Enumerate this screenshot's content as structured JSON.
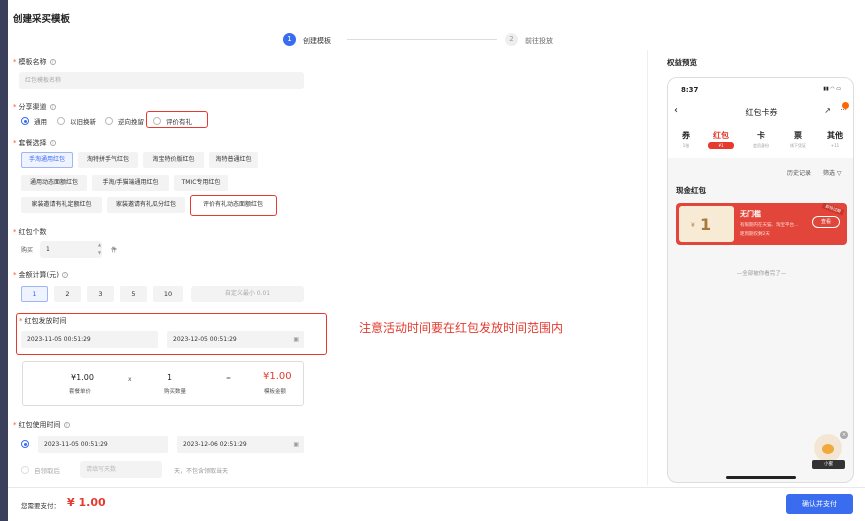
{
  "page": {
    "title": "创建采买模板"
  },
  "steps": [
    {
      "num": "1",
      "label": "创建模板"
    },
    {
      "num": "2",
      "label": "前往投放"
    }
  ],
  "template_name": {
    "label": "模板名称",
    "placeholder": "红包模板名称"
  },
  "share_channel": {
    "label": "分享渠道",
    "options": [
      "通用",
      "以旧换新",
      "逆向挽留",
      "评价有礼"
    ],
    "selected": "通用"
  },
  "package": {
    "label": "套餐选择",
    "options": [
      [
        "手淘通用红包",
        "淘特拼手气红包",
        "淘宝特价版红包",
        "淘特普通红包"
      ],
      [
        "通用动态面额红包",
        "手淘/手猫端通用红包",
        "TMIC专用红包"
      ],
      [
        "家装邀请有礼定额红包",
        "家装邀请有礼瓜分红包",
        "评价有礼动态面额红包"
      ]
    ],
    "selected": "手淘通用红包"
  },
  "count": {
    "label": "红包个数",
    "prefix": "购买",
    "value": "1",
    "unit": "件"
  },
  "amount": {
    "label": "金额计算(元)",
    "options": [
      "1",
      "2",
      "3",
      "5",
      "10"
    ],
    "selected": "1",
    "custom_placeholder": "自定义最小 0.01"
  },
  "issue_time": {
    "label": "红包发放时间",
    "start": "2023-11-05 00:51:29",
    "end": "2023-12-05 00:51:29"
  },
  "summary": {
    "unit_price": "¥1.00",
    "unit_price_label": "套餐单价",
    "times": "x",
    "qty": "1",
    "qty_label": "购买数量",
    "eq": "=",
    "total": "¥1.00",
    "total_label": "模板金额"
  },
  "annotation": "注意活动时间要在红包发放时间范围内",
  "use_time": {
    "label": "红包使用时间",
    "start": "2023-11-05 00:51:29",
    "end": "2023-12-06 02:51:29",
    "alt_prefix": "自领取后",
    "alt_placeholder": "请填写天数",
    "alt_suffix": "天，不包含领取当天"
  },
  "footer": {
    "pay_label": "您需要支付：",
    "pay_value": "¥ 1.00",
    "confirm": "确认并支付"
  },
  "preview": {
    "label": "权益预览",
    "time": "8:37",
    "title": "红包卡券",
    "tabs": [
      {
        "t": "券",
        "s": "1张"
      },
      {
        "t": "红包",
        "s": "¥1"
      },
      {
        "t": "卡",
        "s": "会员身份"
      },
      {
        "t": "票",
        "s": "线下凭证"
      },
      {
        "t": "其他",
        "s": "+11"
      }
    ],
    "history": "历史记录",
    "filter": "筛选",
    "section": "现金红包",
    "coupon_value": "1",
    "coupon_symbol": "¥",
    "card_title": "无门槛",
    "card_desc": "有限期内在天猫、淘宝平台...",
    "card_expire": "距到期仅剩2天",
    "card_btn": "查看",
    "card_tag": "即将过期",
    "end": "—全部被你看完了—",
    "bot_name": "小蜜"
  },
  "colors": {
    "accent": "#3a6cf0",
    "red": "#e43a2f"
  }
}
